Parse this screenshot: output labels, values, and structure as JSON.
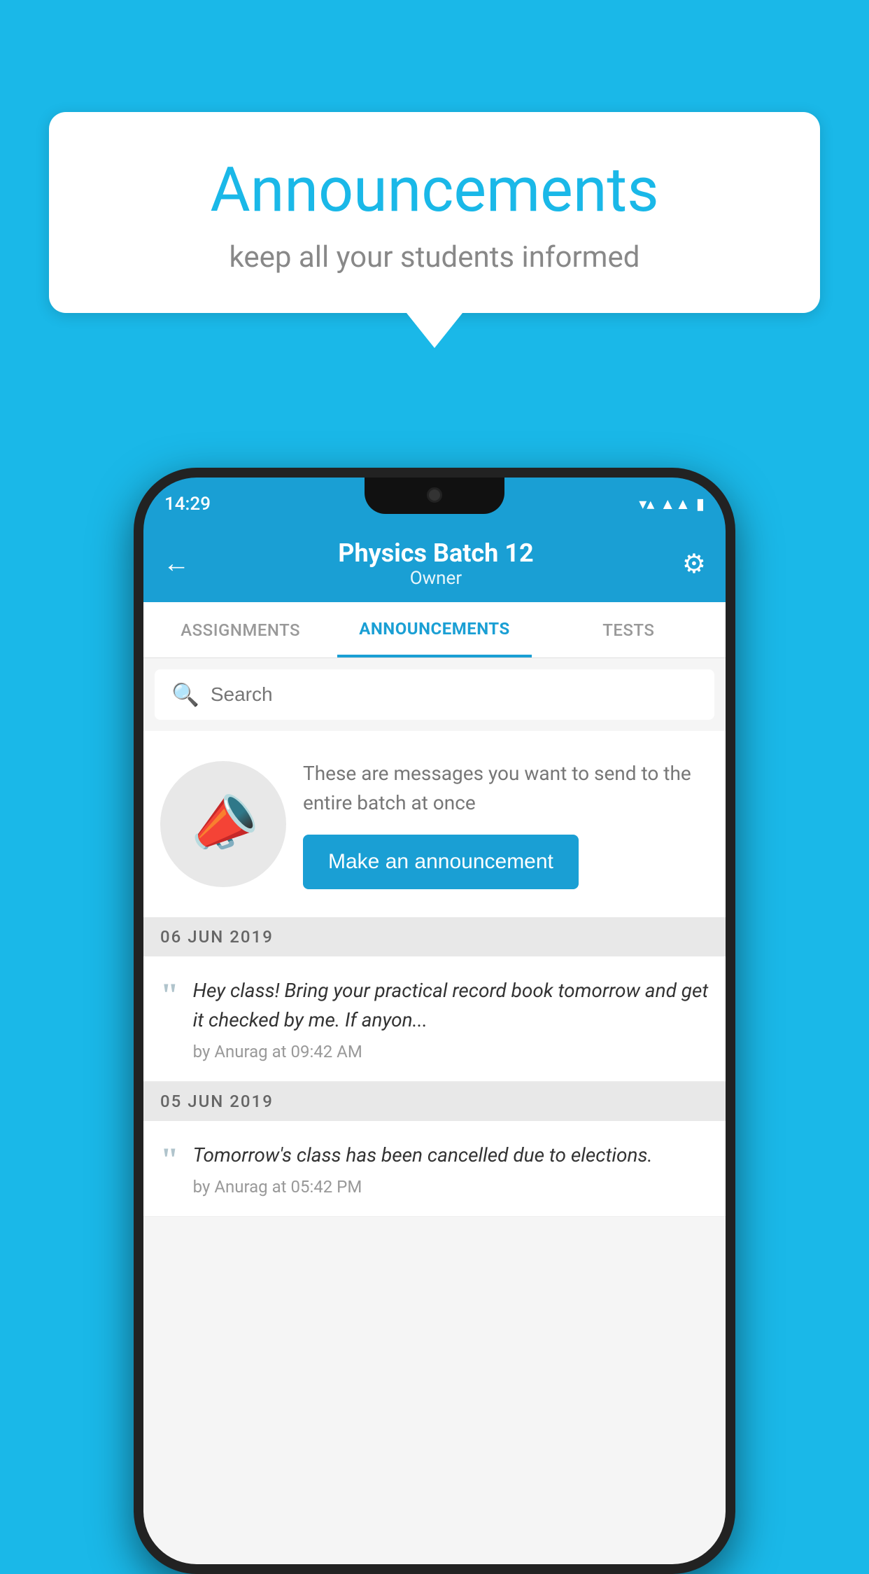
{
  "background_color": "#1ab8e8",
  "speech_bubble": {
    "title": "Announcements",
    "subtitle": "keep all your students informed"
  },
  "phone": {
    "status_bar": {
      "time": "14:29",
      "wifi": "▼",
      "signal": "▲",
      "battery": "▮"
    },
    "header": {
      "back_label": "←",
      "title": "Physics Batch 12",
      "subtitle": "Owner",
      "gear_label": "⚙"
    },
    "tabs": [
      {
        "label": "ASSIGNMENTS",
        "active": false
      },
      {
        "label": "ANNOUNCEMENTS",
        "active": true
      },
      {
        "label": "TESTS",
        "active": false
      }
    ],
    "search": {
      "placeholder": "Search"
    },
    "cta": {
      "description": "These are messages you want to send to the entire batch at once",
      "button_label": "Make an announcement"
    },
    "announcements": [
      {
        "date": "06  JUN  2019",
        "text": "Hey class! Bring your practical record book tomorrow and get it checked by me. If anyon...",
        "meta": "by Anurag at 09:42 AM"
      },
      {
        "date": "05  JUN  2019",
        "text": "Tomorrow's class has been cancelled due to elections.",
        "meta": "by Anurag at 05:42 PM"
      }
    ]
  }
}
